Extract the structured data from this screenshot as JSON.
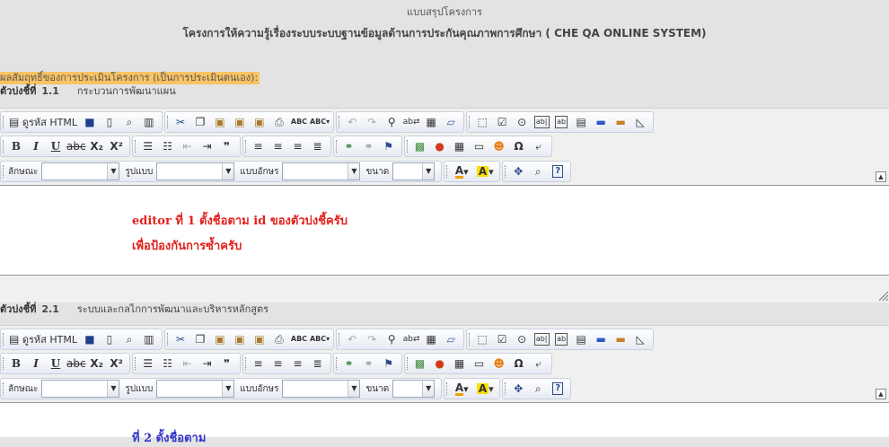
{
  "header": {
    "title": "แบบสรุปโครงการ",
    "project": "โครงการให้ความรู้เรื่องระบบระบบฐานข้อมูลด้านการประกันคุณภาพการศึกษา ( CHE QA ONLINE SYSTEM)"
  },
  "result_label": "ผลสัมฤทธิ์ของการประเมินโครงการ (เป็นการประเมินตนเอง):",
  "indicators": [
    {
      "prefix": "ตัวบ่งชี้ที่",
      "number": "1.1",
      "desc": "กระบวนการพัฒนาแผน"
    },
    {
      "prefix": "ตัวบ่งชี้ที่",
      "number": "2.1",
      "desc": "ระบบและกลไกการพัฒนาและบริหารหลักสูตร"
    }
  ],
  "toolbar": {
    "source_label": "ดูรหัส HTML",
    "format_label": "ลักษณะ",
    "styles_label": "รูปแบบ",
    "font_label": "แบบอักษร",
    "size_label": "ขนาด",
    "subscript": "X₂",
    "superscript": "X²",
    "bold": "B",
    "italic": "I",
    "underline": "U",
    "strike": "abc",
    "quote": "❞",
    "omega": "Ω"
  },
  "editor1": {
    "line1": "editor ที่ 1 ตั้งชื่อตาม id ของตัวบ่งชี้ครับ",
    "line2": "เพื่อป้องกันการซ้ำครับ"
  },
  "editor2": {
    "line1": "ที่ 2 ตั้งชื่อตาม"
  },
  "colors": {
    "background": "#e3e3e3",
    "highlight": "#f9c363",
    "editor_text": "#e3211c",
    "editor_text_2": "#3333cc"
  }
}
